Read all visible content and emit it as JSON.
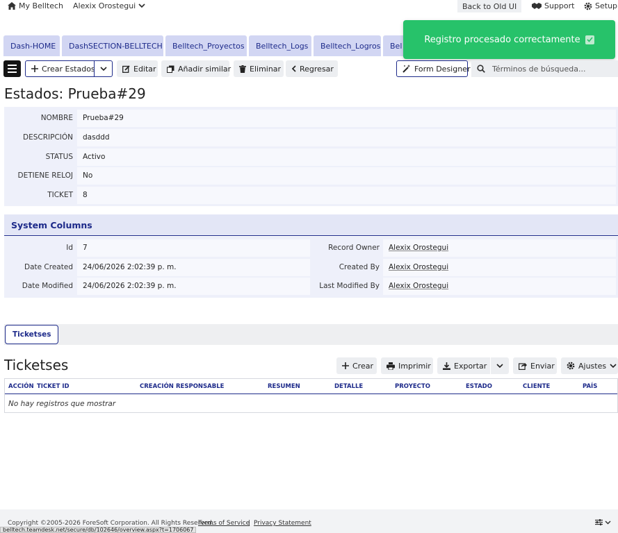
{
  "topbar": {
    "home": "My Belltech",
    "user": "Alexix Orostegui",
    "old_ui": "Back to Old UI",
    "support": "Support",
    "setup": "Setup"
  },
  "tabs": [
    {
      "label": "Dash-HOME"
    },
    {
      "label": "DashSECTION-BELLTECH"
    },
    {
      "label": "Belltech_Proyectos"
    },
    {
      "label": "Belltech_Logs"
    },
    {
      "label": "Belltech_Logros"
    },
    {
      "label": "Bel"
    }
  ],
  "toast": {
    "message": "Registro procesado correctamente"
  },
  "toolbar": {
    "create": "Crear Estados",
    "edit": "Editar",
    "add_similar": "Añadir similar",
    "delete": "Eliminar",
    "back": "Regresar",
    "form_designer": "Form Designer",
    "search_placeholder": "Términos de búsqueda..."
  },
  "page": {
    "title": "Estados: Prueba#29"
  },
  "fields": [
    {
      "label": "NOMBRE",
      "value": "Prueba#29"
    },
    {
      "label": "DESCRIPCIÓN",
      "value": "dasddd"
    },
    {
      "label": "STATUS",
      "value": "Activo"
    },
    {
      "label": "DETIENE RELOJ",
      "value": "No"
    },
    {
      "label": "TICKET",
      "value": "8"
    }
  ],
  "system": {
    "title": "System Columns",
    "left": [
      {
        "label": "Id",
        "value": "7"
      },
      {
        "label": "Date Created",
        "value": "24/06/2026 2:02:39 p. m."
      },
      {
        "label": "Date Modified",
        "value": "24/06/2026 2:02:39 p. m."
      }
    ],
    "right": [
      {
        "label": "Record Owner",
        "value": "Alexix Orostegui"
      },
      {
        "label": "Created By",
        "value": "Alexix Orostegui"
      },
      {
        "label": "Last Modified By",
        "value": "Alexix Orostegui"
      }
    ]
  },
  "subtab": {
    "label": "Ticketses"
  },
  "ticketses": {
    "title": "Ticketses",
    "buttons": {
      "create": "Crear",
      "print": "Imprimir",
      "export": "Exportar",
      "send": "Enviar",
      "settings": "Ajustes"
    },
    "columns": [
      "ACCIÓN",
      "TICKET ID",
      "CREACIÓN",
      "RESPONSABLE",
      "RESUMEN",
      "DETALLE",
      "PROYECTO",
      "ESTADO",
      "CLIENTE",
      "PAÍS"
    ],
    "empty": "No hay registros que mostrar"
  },
  "footer": {
    "copyright": "Copyright ©2005-2026 ForeSoft Corporation. All Rights Reserved.",
    "terms": "Terms of Service",
    "sep": "|",
    "privacy": "Privacy Statement",
    "status_url": "belltech.teamdesk.net/secure/db/102646/overview.aspx?t=1706067"
  },
  "colors": {
    "accent": "#1d2a8a",
    "tab_bg": "#d2d6f3",
    "toast_bg": "#27c26a",
    "panel_bg": "#eef0fa"
  }
}
